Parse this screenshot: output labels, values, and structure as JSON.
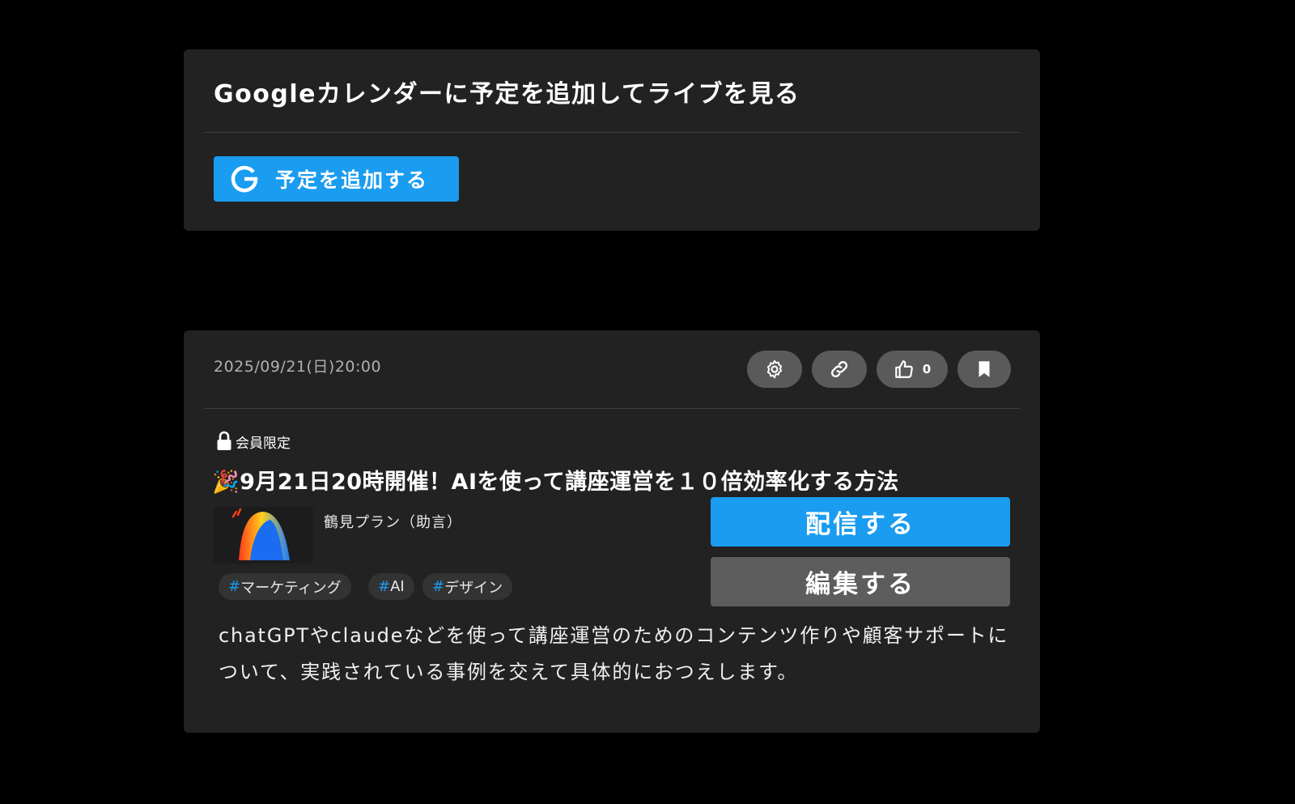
{
  "calendar_card": {
    "title": "Googleカレンダーに予定を追加してライブを見る",
    "add_button_label": "予定を追加する",
    "add_button_icon": "google-g-icon"
  },
  "event_card": {
    "date": "2025/09/21(日)20:00",
    "actions": {
      "settings_icon": "gear-icon",
      "link_icon": "link-icon",
      "like_icon": "thumbs-up-icon",
      "like_count": "0",
      "bookmark_icon": "bookmark-icon"
    },
    "members_only_label": "会員限定",
    "title": "🎉9月21日20時開催！AIを使って講座運営を１０倍効率化する方法",
    "plan_name": "鶴見プラン（助言）",
    "tags": [
      {
        "hash": "#",
        "label": "マーケティング"
      },
      {
        "hash": "#",
        "label": "AI"
      },
      {
        "hash": "#",
        "label": "デザイン"
      }
    ],
    "stream_button_label": "配信する",
    "edit_button_label": "編集する",
    "description": "chatGPTやclaudeなどを使って講座運営のためのコンテンツ作りや顧客サポートについて、実践されている事例を交えて具体的におつえします。"
  },
  "colors": {
    "background": "#000000",
    "card": "#222222",
    "accent_blue": "#1a9cf0",
    "secondary_button": "#5d5d5d"
  }
}
